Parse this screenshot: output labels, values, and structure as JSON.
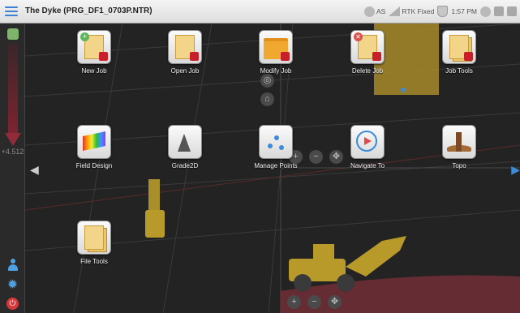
{
  "app": {
    "title": "The Dyke (PRG_DF1_0703P.NTR)"
  },
  "status_bar": {
    "as_label": "AS",
    "rtk_label": "RTK Fixed",
    "time": "1:57 PM"
  },
  "sidebar": {
    "cut_value": "+4.512"
  },
  "launcher": {
    "tiles": [
      {
        "label": "New Job"
      },
      {
        "label": "Open Job"
      },
      {
        "label": "Modify Job"
      },
      {
        "label": "Delete Job"
      },
      {
        "label": "Job Tools"
      },
      {
        "label": "Field Design"
      },
      {
        "label": "Grade2D"
      },
      {
        "label": "Manage Points"
      },
      {
        "label": "Navigate To"
      },
      {
        "label": "Topo"
      },
      {
        "label": "File Tools"
      }
    ]
  },
  "colors": {
    "accent": "#3d7fd0",
    "cut": "#7d2430",
    "map_background": "#232323",
    "machine": "#b89a2a"
  }
}
